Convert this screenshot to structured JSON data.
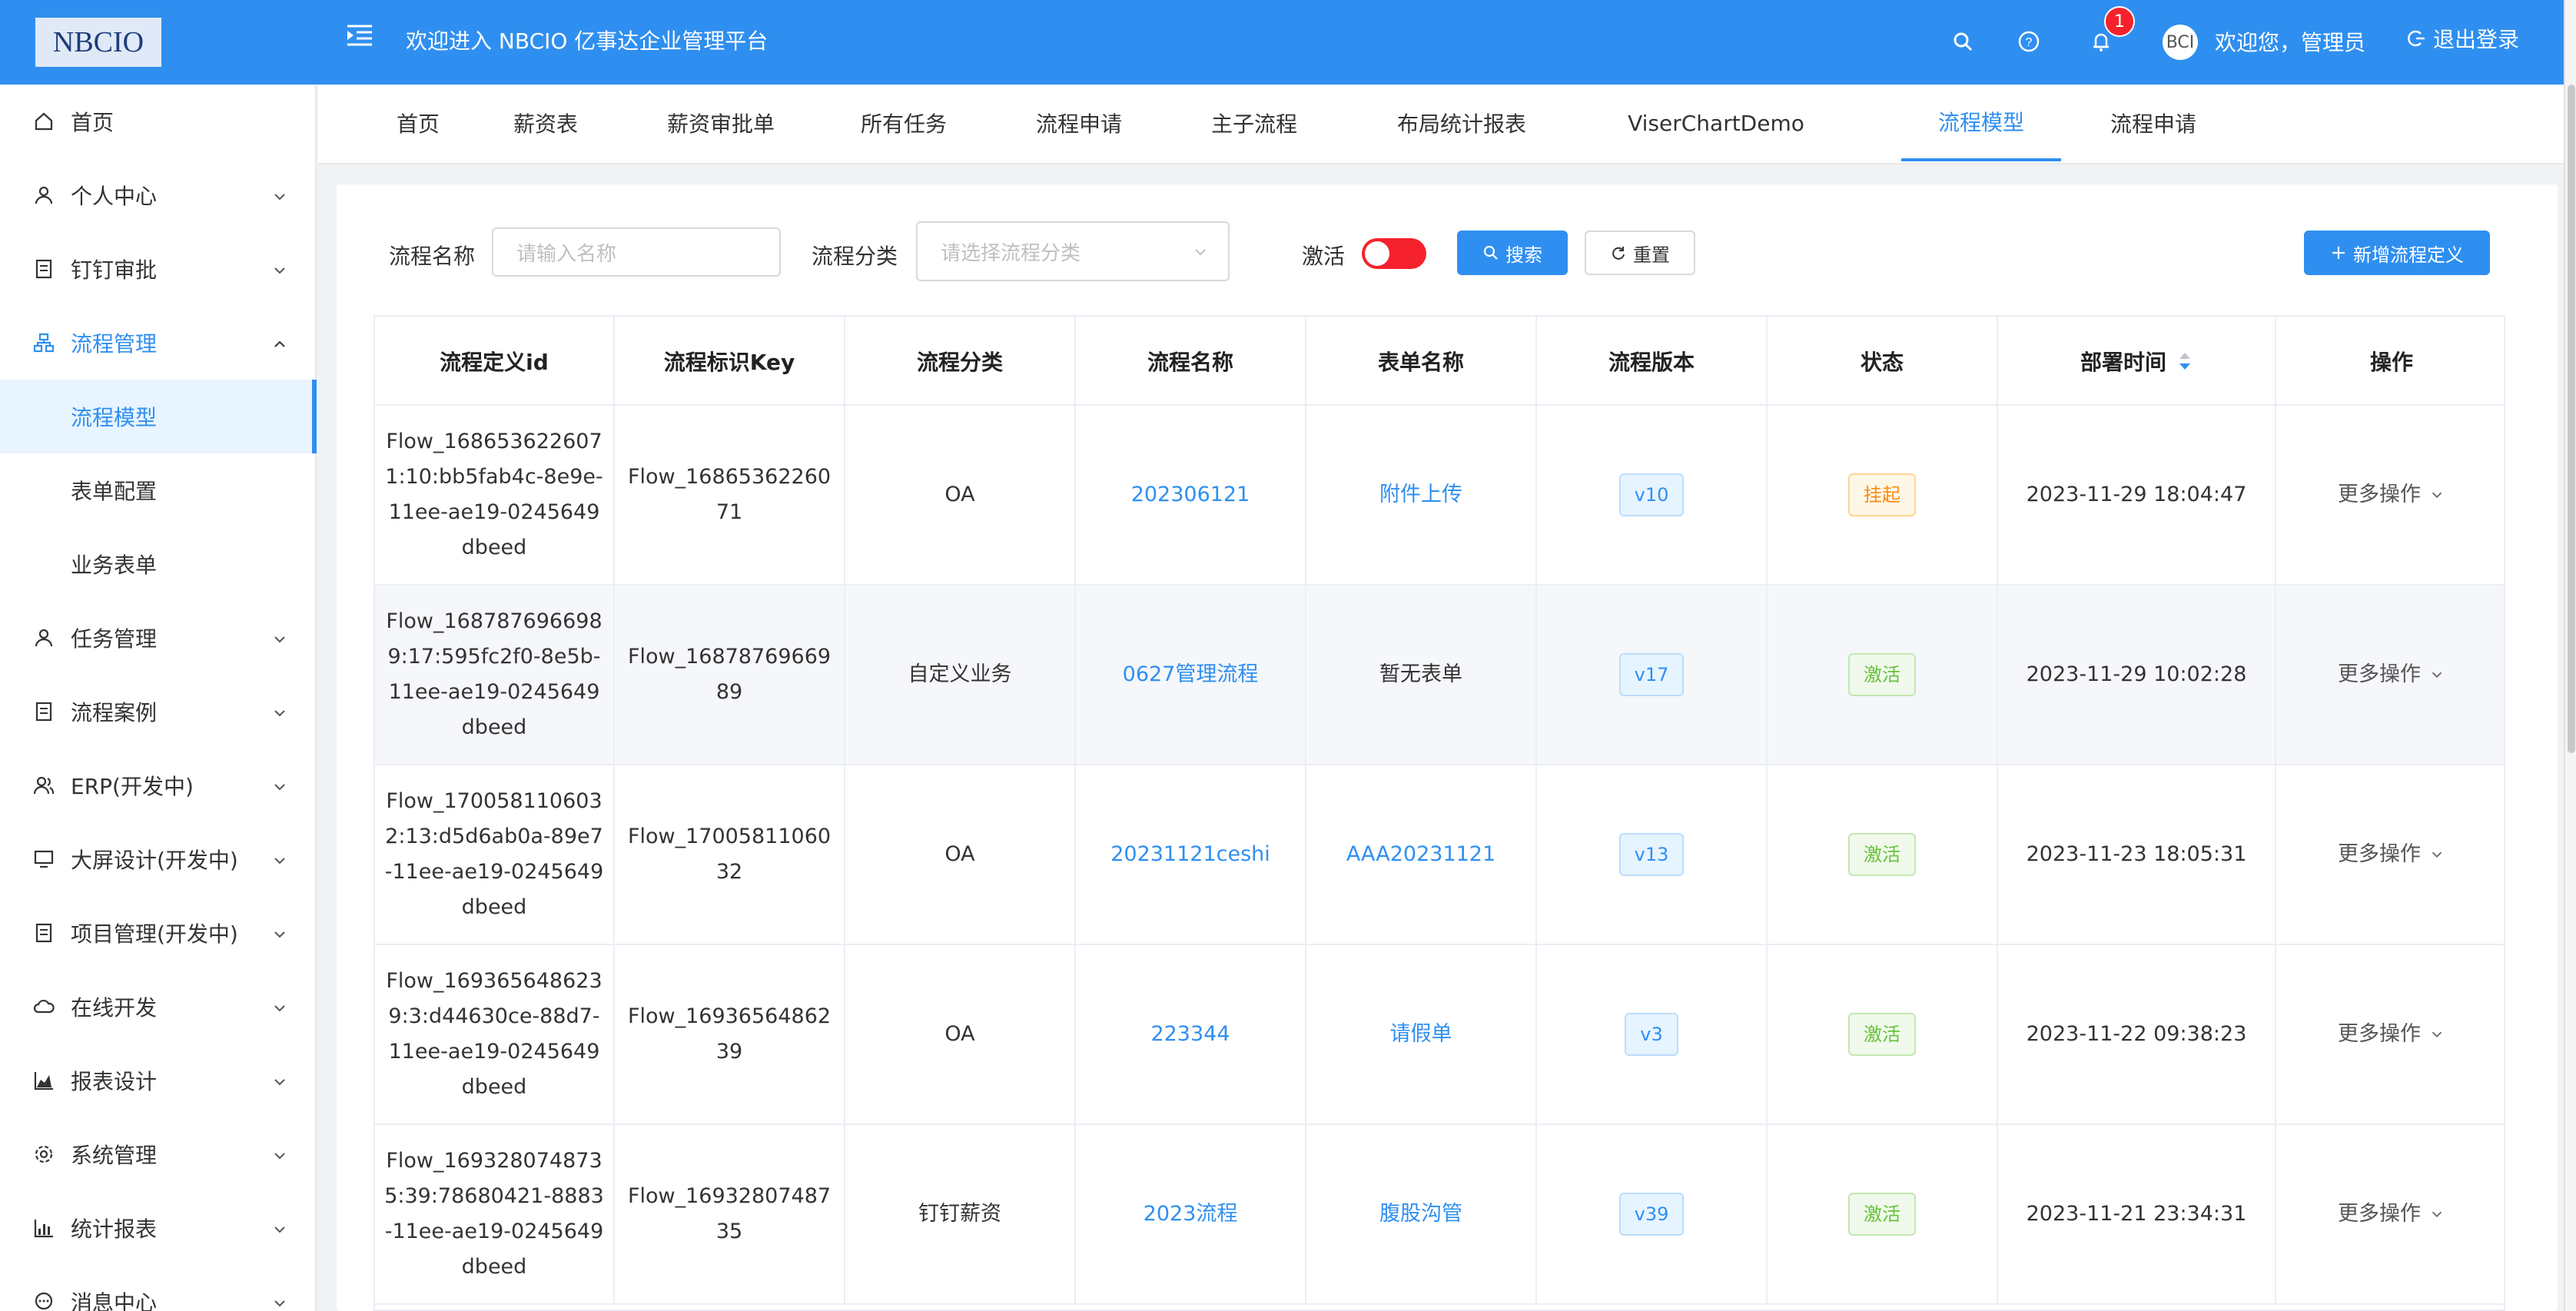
{
  "header": {
    "logo": "NBCIO",
    "welcome": "欢迎进入 NBCIO 亿事达企业管理平台",
    "notification_count": "1",
    "avatar_text": "BCI",
    "greeting": "欢迎您，管理员",
    "logout": "退出登录"
  },
  "sidebar": {
    "items": [
      {
        "label": "首页",
        "icon": "home-icon"
      },
      {
        "label": "个人中心",
        "icon": "user-icon"
      },
      {
        "label": "钉钉审批",
        "icon": "document-icon"
      },
      {
        "label": "流程管理",
        "icon": "hierarchy-icon"
      },
      {
        "label": "任务管理",
        "icon": "user-icon"
      },
      {
        "label": "流程案例",
        "icon": "document-icon"
      },
      {
        "label": "ERP(开发中)",
        "icon": "team-icon"
      },
      {
        "label": "大屏设计(开发中)",
        "icon": "monitor-icon"
      },
      {
        "label": "项目管理(开发中)",
        "icon": "document-icon"
      },
      {
        "label": "在线开发",
        "icon": "cloud-icon"
      },
      {
        "label": "报表设计",
        "icon": "area-chart-icon"
      },
      {
        "label": "系统管理",
        "icon": "gear-icon"
      },
      {
        "label": "统计报表",
        "icon": "bar-chart-icon"
      },
      {
        "label": "消息中心",
        "icon": "message-icon"
      }
    ],
    "subitems": [
      {
        "label": "流程模型"
      },
      {
        "label": "表单配置"
      },
      {
        "label": "业务表单"
      }
    ]
  },
  "tabs": [
    "首页",
    "薪资表",
    "薪资审批单",
    "所有任务",
    "流程申请",
    "主子流程",
    "布局统计报表",
    "ViserChartDemo",
    "流程模型",
    "流程申请"
  ],
  "filters": {
    "name_label": "流程名称",
    "name_placeholder": "请输入名称",
    "category_label": "流程分类",
    "category_placeholder": "请选择流程分类",
    "active_label": "激活",
    "search": "搜索",
    "reset": "重置",
    "add": "新增流程定义"
  },
  "table": {
    "headers": [
      "流程定义id",
      "流程标识Key",
      "流程分类",
      "流程名称",
      "表单名称",
      "流程版本",
      "状态",
      "部署时间",
      "操作"
    ],
    "rows": [
      {
        "id": "Flow_1686536226071:10:bb5fab4c-8e9e-11ee-ae19-0245649dbeed",
        "key": "Flow_1686536226071",
        "category": "OA",
        "name": "202306121",
        "form": "附件上传",
        "form_link": true,
        "version": "v10",
        "status": "挂起",
        "status_type": "susp",
        "time": "2023-11-29 18:04:47",
        "action": "更多操作"
      },
      {
        "id": "Flow_1687876966989:17:595fc2f0-8e5b-11ee-ae19-0245649dbeed",
        "key": "Flow_1687876966989",
        "category": "自定义业务",
        "name": "0627管理流程",
        "form": "暂无表单",
        "form_link": false,
        "version": "v17",
        "status": "激活",
        "status_type": "act",
        "time": "2023-11-29 10:02:28",
        "action": "更多操作"
      },
      {
        "id": "Flow_1700581106032:13:d5d6ab0a-89e7-11ee-ae19-0245649dbeed",
        "key": "Flow_1700581106032",
        "category": "OA",
        "name": "20231121ceshi",
        "form": "AAA20231121",
        "form_link": true,
        "version": "v13",
        "status": "激活",
        "status_type": "act",
        "time": "2023-11-23 18:05:31",
        "action": "更多操作"
      },
      {
        "id": "Flow_1693656486239:3:d44630ce-88d7-11ee-ae19-0245649dbeed",
        "key": "Flow_1693656486239",
        "category": "OA",
        "name": "223344",
        "form": "请假单",
        "form_link": true,
        "version": "v3",
        "status": "激活",
        "status_type": "act",
        "time": "2023-11-22 09:38:23",
        "action": "更多操作"
      },
      {
        "id": "Flow_1693280748735:39:78680421-8883-11ee-ae19-0245649dbeed",
        "key": "Flow_1693280748735",
        "category": "钉钉薪资",
        "name": "2023流程",
        "form": "腹股沟管",
        "form_link": true,
        "version": "v39",
        "status": "激活",
        "status_type": "act",
        "time": "2023-11-21 23:34:31",
        "action": "更多操作"
      }
    ]
  },
  "colors": {
    "primary": "#2f8ff0",
    "danger": "#f5222d",
    "warning": "#fa8c16",
    "success": "#67c23a"
  }
}
